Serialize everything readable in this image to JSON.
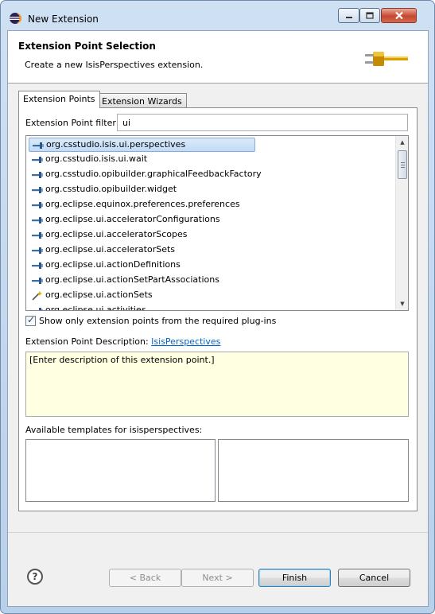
{
  "window": {
    "title": "New Extension"
  },
  "banner": {
    "title": "Extension Point Selection",
    "message": "Create a new IsisPerspectives extension."
  },
  "tabs": [
    {
      "label": "Extension Points",
      "active": true
    },
    {
      "label": "Extension Wizards",
      "active": false
    }
  ],
  "filter": {
    "label": "Extension Point filter:",
    "value": "ui"
  },
  "extension_points": [
    {
      "label": "org.csstudio.isis.ui.perspectives",
      "icon": "extension-point-icon",
      "selected": true
    },
    {
      "label": "org.csstudio.isis.ui.wait",
      "icon": "extension-point-icon"
    },
    {
      "label": "org.csstudio.opibuilder.graphicalFeedbackFactory",
      "icon": "extension-point-icon"
    },
    {
      "label": "org.csstudio.opibuilder.widget",
      "icon": "extension-point-icon"
    },
    {
      "label": "org.eclipse.equinox.preferences.preferences",
      "icon": "extension-point-icon"
    },
    {
      "label": "org.eclipse.ui.acceleratorConfigurations",
      "icon": "extension-point-icon"
    },
    {
      "label": "org.eclipse.ui.acceleratorScopes",
      "icon": "extension-point-icon"
    },
    {
      "label": "org.eclipse.ui.acceleratorSets",
      "icon": "extension-point-icon"
    },
    {
      "label": "org.eclipse.ui.actionDefinitions",
      "icon": "extension-point-icon"
    },
    {
      "label": "org.eclipse.ui.actionSetPartAssociations",
      "icon": "extension-point-icon"
    },
    {
      "label": "org.eclipse.ui.actionSets",
      "icon": "extension-point-wizard-icon"
    },
    {
      "label": "org.eclipse.ui.activities",
      "icon": "extension-point-icon"
    }
  ],
  "show_required_only": {
    "label": "Show only extension points from the required plug-ins",
    "checked": true
  },
  "description": {
    "label": "Extension Point Description:",
    "link": "IsisPerspectives",
    "text": "[Enter description of this extension point.]"
  },
  "templates": {
    "label": "Available templates for isisperspectives:"
  },
  "buttons": {
    "back": "< Back",
    "next": "Next >",
    "finish": "Finish",
    "cancel": "Cancel"
  },
  "colors": {
    "description_background": "#ffffe1",
    "selection": "#c1dbf7",
    "link": "#0066cc"
  }
}
